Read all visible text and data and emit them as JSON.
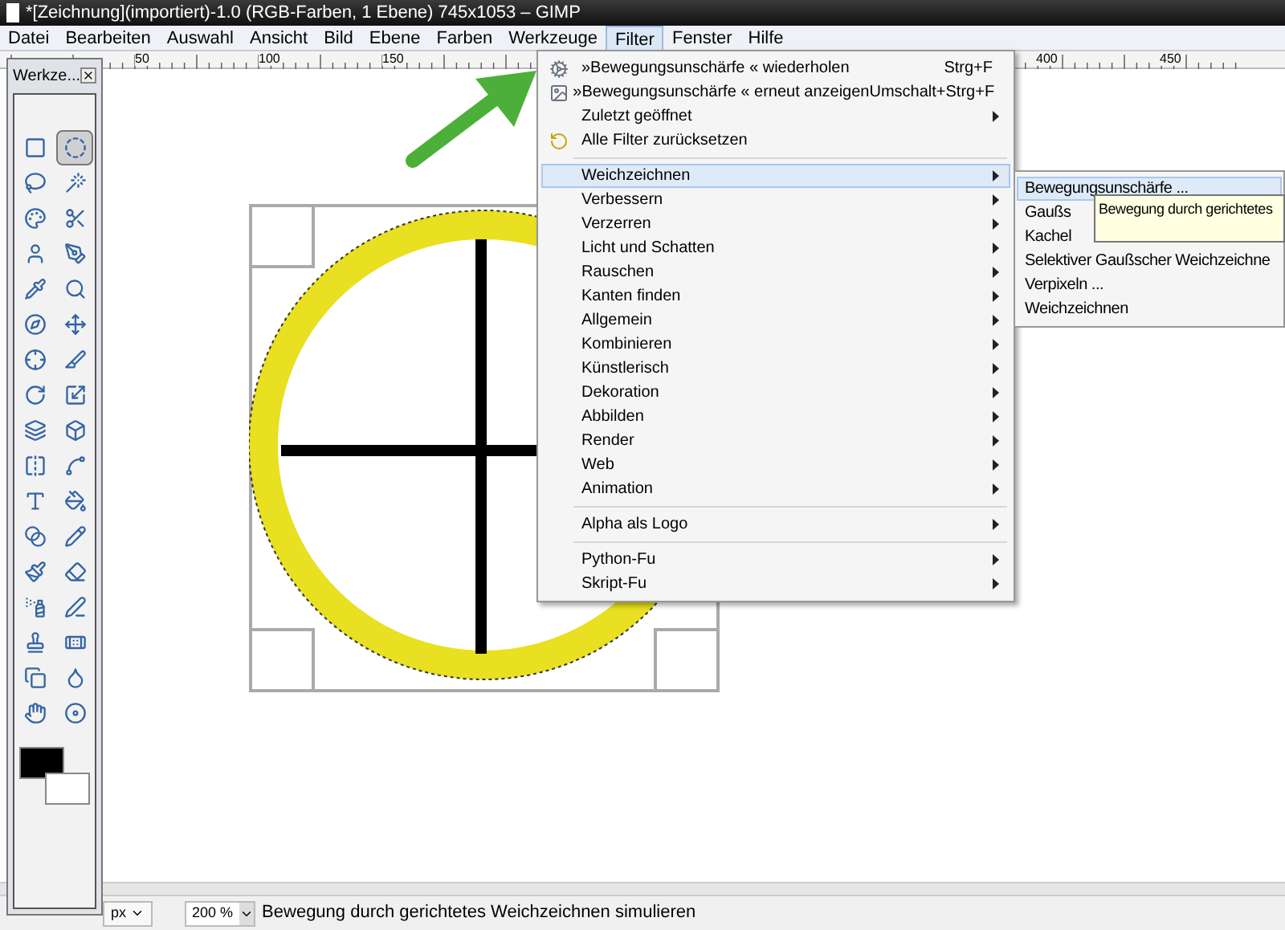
{
  "window": {
    "title": "*[Zeichnung](importiert)-1.0 (RGB-Farben, 1 Ebene) 745x1053 – GIMP"
  },
  "menu_bar": [
    {
      "label": "Datei",
      "selected": false
    },
    {
      "label": "Bearbeiten",
      "selected": false
    },
    {
      "label": "Auswahl",
      "selected": false
    },
    {
      "label": "Ansicht",
      "selected": false
    },
    {
      "label": "Bild",
      "selected": false
    },
    {
      "label": "Ebene",
      "selected": false
    },
    {
      "label": "Farben",
      "selected": false
    },
    {
      "label": "Werkzeuge",
      "selected": false
    },
    {
      "label": "Filter",
      "selected": true
    },
    {
      "label": "Fenster",
      "selected": false
    },
    {
      "label": "Hilfe",
      "selected": false
    }
  ],
  "ruler": {
    "labels": [
      "50",
      "100",
      "150",
      "400",
      "450"
    ]
  },
  "toolbox": {
    "title": "Werkze...",
    "tools": [
      {
        "selected": false
      },
      {
        "selected": true
      },
      {
        "selected": false
      },
      {
        "selected": false
      },
      {
        "selected": false
      },
      {
        "selected": false
      },
      {
        "selected": false
      },
      {
        "selected": false
      },
      {
        "selected": false
      },
      {
        "selected": false
      },
      {
        "selected": false
      },
      {
        "selected": false
      },
      {
        "selected": false
      },
      {
        "selected": false
      },
      {
        "selected": false
      },
      {
        "selected": false
      },
      {
        "selected": false
      },
      {
        "selected": false
      },
      {
        "selected": false
      },
      {
        "selected": false
      },
      {
        "selected": false
      },
      {
        "selected": false
      },
      {
        "selected": false
      },
      {
        "selected": false
      },
      {
        "selected": false
      },
      {
        "selected": false
      },
      {
        "selected": false
      },
      {
        "selected": false
      },
      {
        "selected": false
      },
      {
        "selected": false
      },
      {
        "selected": false
      },
      {
        "selected": false
      },
      {
        "selected": false
      },
      {
        "selected": false
      }
    ]
  },
  "filter_menu": {
    "items": [
      {
        "kind": "repeat",
        "label": "»Bewegungsunschärfe « wiederholen",
        "shortcut": "Strg+F",
        "has_submenu": false,
        "selected": false
      },
      {
        "kind": "reshow",
        "label": "»Bewegungsunschärfe « erneut anzeigen",
        "shortcut": "Umschalt+Strg+F",
        "has_submenu": false,
        "selected": false
      },
      {
        "kind": "item",
        "label": "Zuletzt geöffnet",
        "has_submenu": true,
        "selected": false
      },
      {
        "kind": "reset",
        "label": "Alle Filter zurücksetzen",
        "has_submenu": false,
        "selected": false
      },
      {
        "kind": "separator"
      },
      {
        "kind": "item",
        "label": "Weichzeichnen",
        "has_submenu": true,
        "selected": true
      },
      {
        "kind": "item",
        "label": "Verbessern",
        "has_submenu": true,
        "selected": false
      },
      {
        "kind": "item",
        "label": "Verzerren",
        "has_submenu": true,
        "selected": false
      },
      {
        "kind": "item",
        "label": "Licht und Schatten",
        "has_submenu": true,
        "selected": false
      },
      {
        "kind": "item",
        "label": "Rauschen",
        "has_submenu": true,
        "selected": false
      },
      {
        "kind": "item",
        "label": "Kanten finden",
        "has_submenu": true,
        "selected": false
      },
      {
        "kind": "item",
        "label": "Allgemein",
        "has_submenu": true,
        "selected": false
      },
      {
        "kind": "item",
        "label": "Kombinieren",
        "has_submenu": true,
        "selected": false
      },
      {
        "kind": "item",
        "label": "Künstlerisch",
        "has_submenu": true,
        "selected": false
      },
      {
        "kind": "item",
        "label": "Dekoration",
        "has_submenu": true,
        "selected": false
      },
      {
        "kind": "item",
        "label": "Abbilden",
        "has_submenu": true,
        "selected": false
      },
      {
        "kind": "item",
        "label": "Render",
        "has_submenu": true,
        "selected": false
      },
      {
        "kind": "item",
        "label": "Web",
        "has_submenu": true,
        "selected": false
      },
      {
        "kind": "item",
        "label": "Animation",
        "has_submenu": true,
        "selected": false
      },
      {
        "kind": "separator"
      },
      {
        "kind": "item",
        "label": "Alpha als Logo",
        "has_submenu": true,
        "selected": false
      },
      {
        "kind": "separator"
      },
      {
        "kind": "item",
        "label": "Python-Fu",
        "has_submenu": true,
        "selected": false
      },
      {
        "kind": "item",
        "label": "Skript-Fu",
        "has_submenu": true,
        "selected": false
      }
    ]
  },
  "submenu": {
    "items": [
      {
        "label": "Bewegungsunschärfe ...",
        "selected": true
      },
      {
        "label": "Gaußs",
        "selected": false
      },
      {
        "label": "Kachel",
        "selected": false
      },
      {
        "label": "Selektiver Gaußscher Weichzeichne",
        "selected": false
      },
      {
        "label": "Verpixeln ...",
        "selected": false
      },
      {
        "label": "Weichzeichnen",
        "selected": false
      }
    ]
  },
  "tooltip": {
    "text": "Bewegung durch gerichtetes"
  },
  "status_bar": {
    "unit": "px",
    "zoom": "200 %",
    "message": "Bewegung durch gerichtetes Weichzeichnen simulieren"
  }
}
